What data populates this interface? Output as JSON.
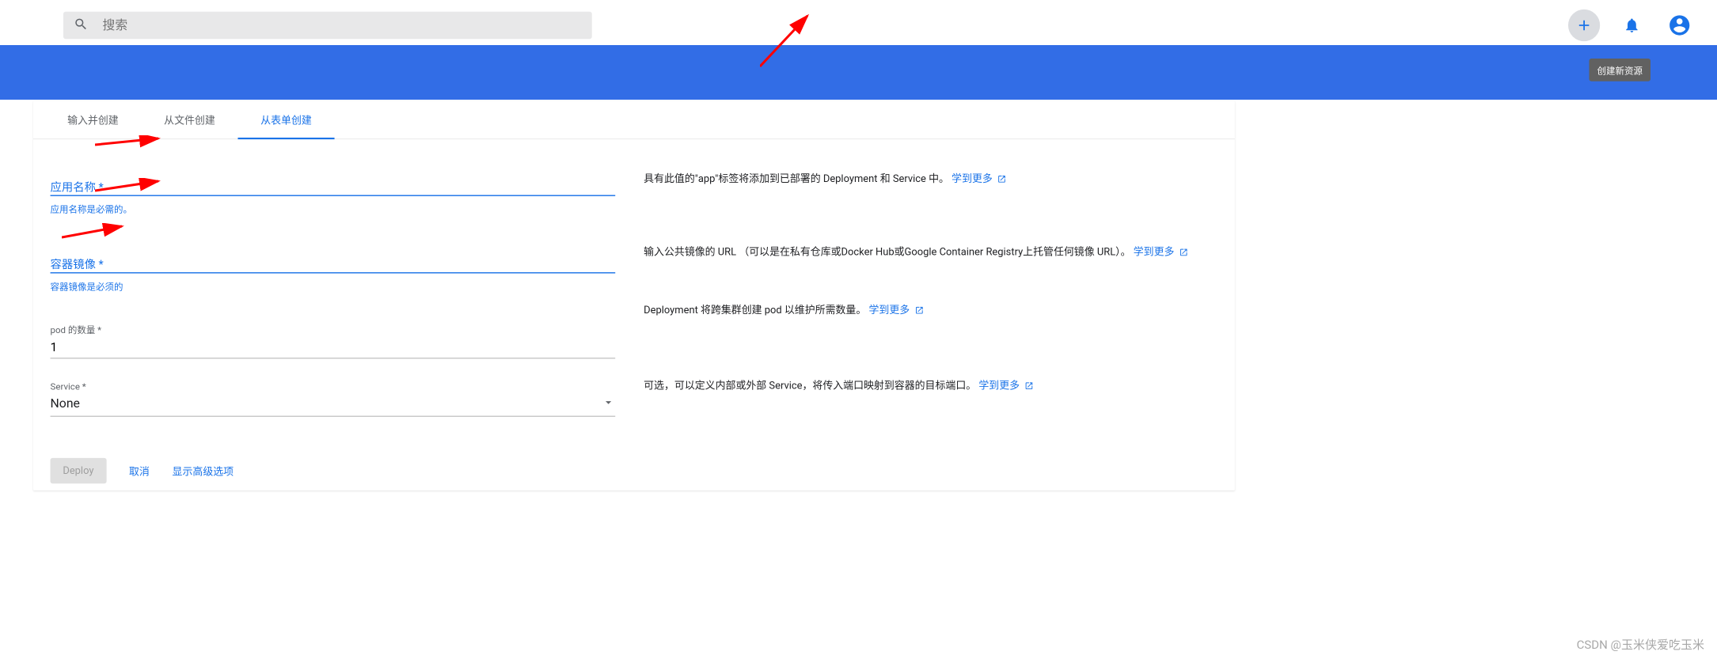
{
  "search": {
    "placeholder": "搜索"
  },
  "tooltip": {
    "create": "创建新资源"
  },
  "tabs": [
    {
      "label": "输入并创建",
      "active": false
    },
    {
      "label": "从文件创建",
      "active": false
    },
    {
      "label": "从表单创建",
      "active": true
    }
  ],
  "form": {
    "appName": {
      "label": "应用名称 *",
      "value": "",
      "error": "应用名称是必需的。"
    },
    "containerImage": {
      "label": "容器镜像 *",
      "value": "",
      "error": "容器镜像是必须的"
    },
    "podCount": {
      "label": "pod 的数量 *",
      "value": "1"
    },
    "service": {
      "label": "Service *",
      "value": "None"
    }
  },
  "help": {
    "appName": {
      "text": "具有此值的\"app\"标签将添加到已部署的 Deployment 和 Service 中。 ",
      "learnMore": "学到更多"
    },
    "containerImage": {
      "text": "输入公共镜像的 URL （可以是在私有仓库或Docker Hub或Google Container Registry上托管任何镜像 URL）。 ",
      "learnMore": "学到更多"
    },
    "podCount": {
      "text": "Deployment 将跨集群创建 pod 以维护所需数量。 ",
      "learnMore": "学到更多"
    },
    "service": {
      "text": "可选，可以定义内部或外部 Service，将传入端口映射到容器的目标端口。 ",
      "learnMore": "学到更多"
    }
  },
  "actions": {
    "deploy": "Deploy",
    "cancel": "取消",
    "advanced": "显示高级选项"
  },
  "watermark": "CSDN @玉米侠爱吃玉米"
}
